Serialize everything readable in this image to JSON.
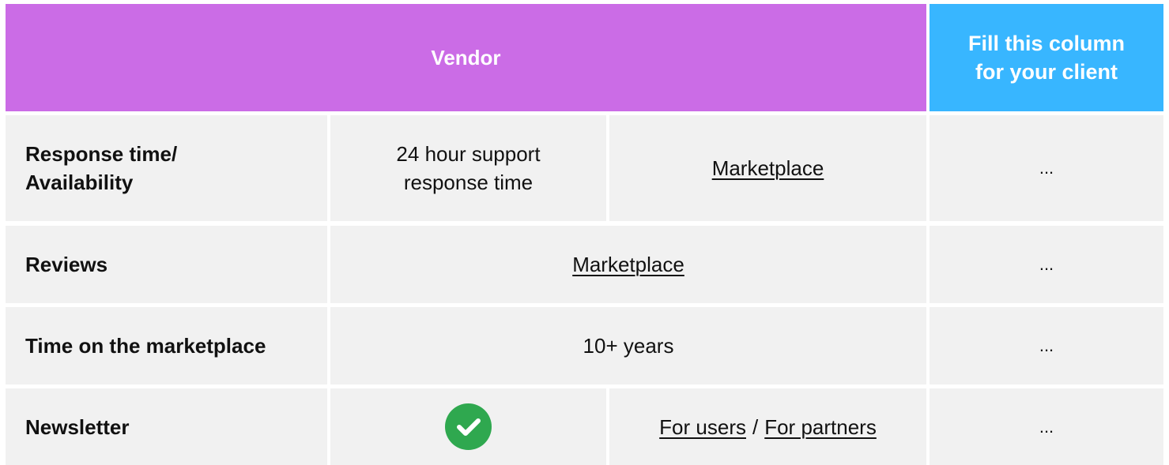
{
  "header": {
    "vendor_label": "Vendor",
    "client_line1": "Fill this column",
    "client_line2": "for your client"
  },
  "rows": {
    "response": {
      "label_line1": "Response time/",
      "label_line2": "Availability",
      "value_line1": "24 hour support",
      "value_line2": "response time",
      "link": "Marketplace",
      "client": "..."
    },
    "reviews": {
      "label": "Reviews",
      "link": "Marketplace",
      "client": "..."
    },
    "time": {
      "label": "Time on the marketplace",
      "value": "10+ years",
      "client": "..."
    },
    "newsletter": {
      "label": "Newsletter",
      "icon": "check-circle-icon",
      "link_users": "For users",
      "separator": "/",
      "link_partners": "For partners",
      "client": "..."
    }
  },
  "colors": {
    "vendor_header": "#cb6ce6",
    "client_header": "#38b6ff",
    "cell_background": "#f1f1f1",
    "check": "#2fa84f"
  }
}
